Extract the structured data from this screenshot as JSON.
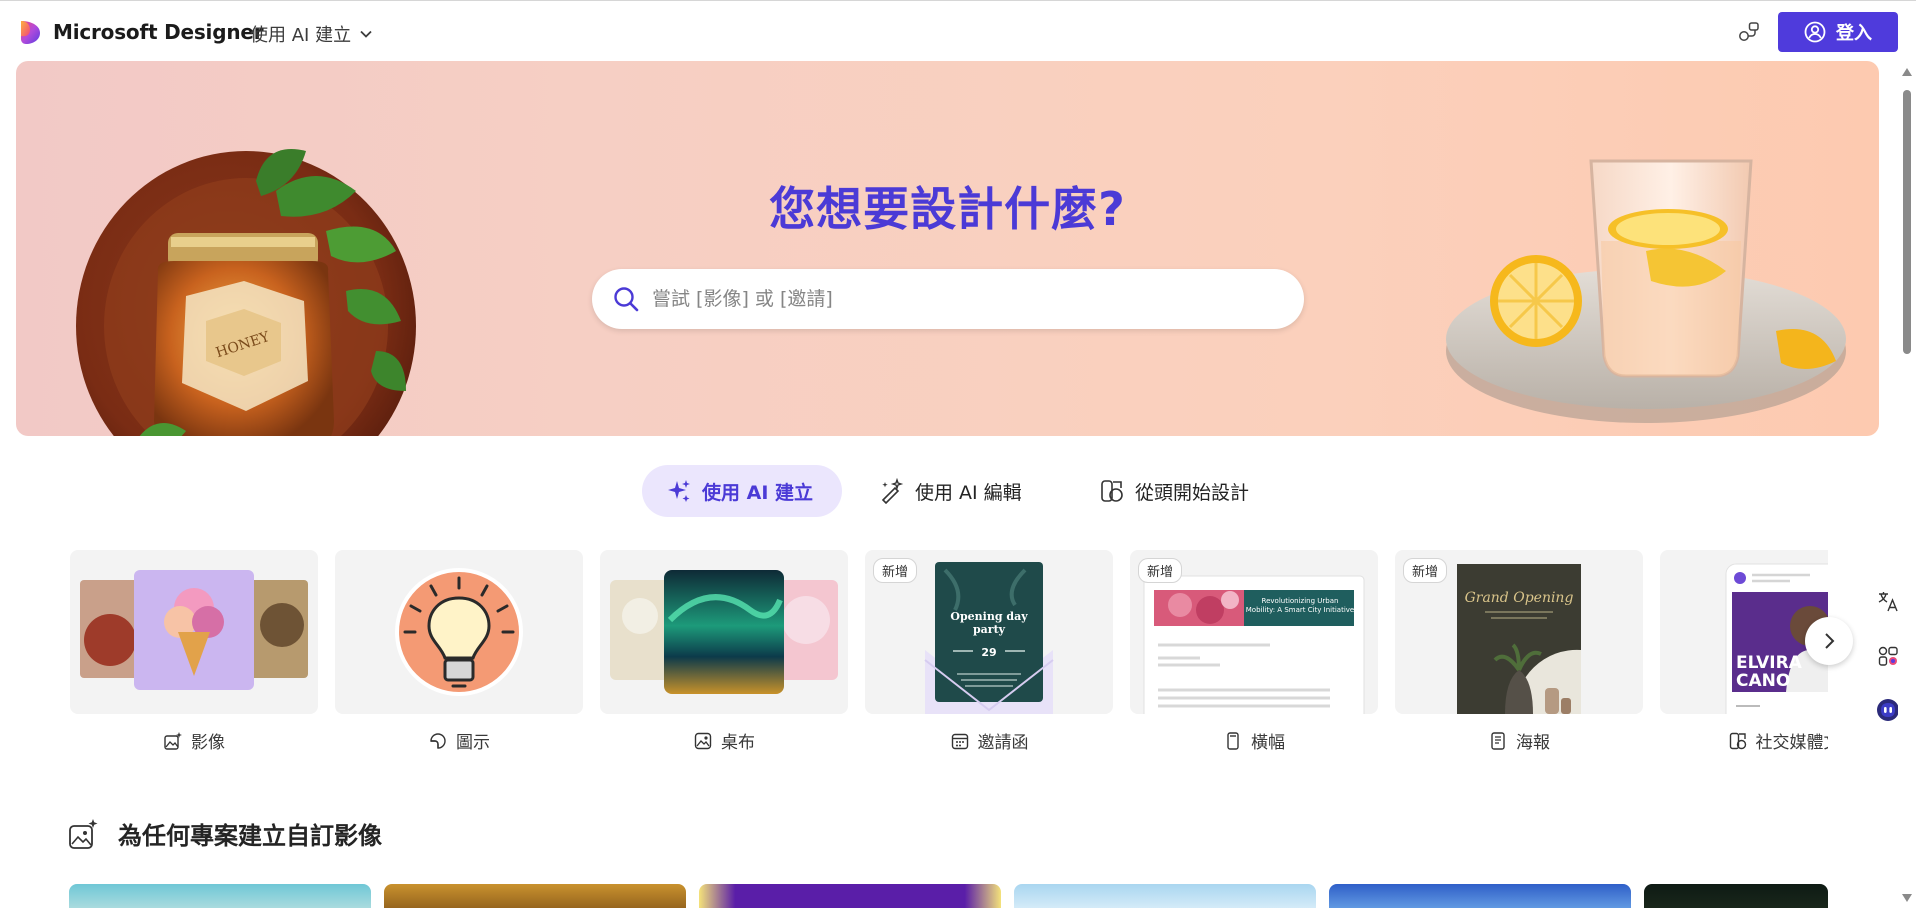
{
  "app": {
    "brand": "Microsoft Designer",
    "mode_menu_label": "使用 AI 建立",
    "signin_label": "登入"
  },
  "hero": {
    "title": "您想要設計什麼?",
    "search_placeholder": "嘗試 [影像] 或 [邀請]"
  },
  "tabs": [
    {
      "label": "使用 AI 建立",
      "active": true,
      "icon": "sparkle-icon"
    },
    {
      "label": "使用 AI 編輯",
      "active": false,
      "icon": "magic-wand-icon"
    },
    {
      "label": "從頭開始設計",
      "active": false,
      "icon": "shapes-icon"
    }
  ],
  "cards": [
    {
      "label": "影像",
      "icon": "image-sparkle-icon",
      "badge": ""
    },
    {
      "label": "圖示",
      "icon": "sticker-icon",
      "badge": ""
    },
    {
      "label": "桌布",
      "icon": "wallpaper-icon",
      "badge": ""
    },
    {
      "label": "邀請函",
      "icon": "calendar-icon",
      "badge": "新增",
      "art": {
        "heading": "Opening day party",
        "day": "29"
      }
    },
    {
      "label": "橫幅",
      "icon": "banner-icon",
      "badge": "新增",
      "art": {
        "headline": "Revolutionizing Urban Mobility: A Smart City Initiative"
      }
    },
    {
      "label": "海報",
      "icon": "poster-icon",
      "badge": "新增",
      "art": {
        "heading": "Grand Opening"
      }
    },
    {
      "label": "社交媒體文",
      "icon": "social-icon",
      "badge": "",
      "art": {
        "name": "ELVIRA CANO"
      }
    }
  ],
  "section": {
    "title": "為任何專案建立自訂影像"
  },
  "colors": {
    "accent": "#4f3bdc",
    "title": "#4b3ad6",
    "tab_active_bg": "#ebe6fd"
  }
}
